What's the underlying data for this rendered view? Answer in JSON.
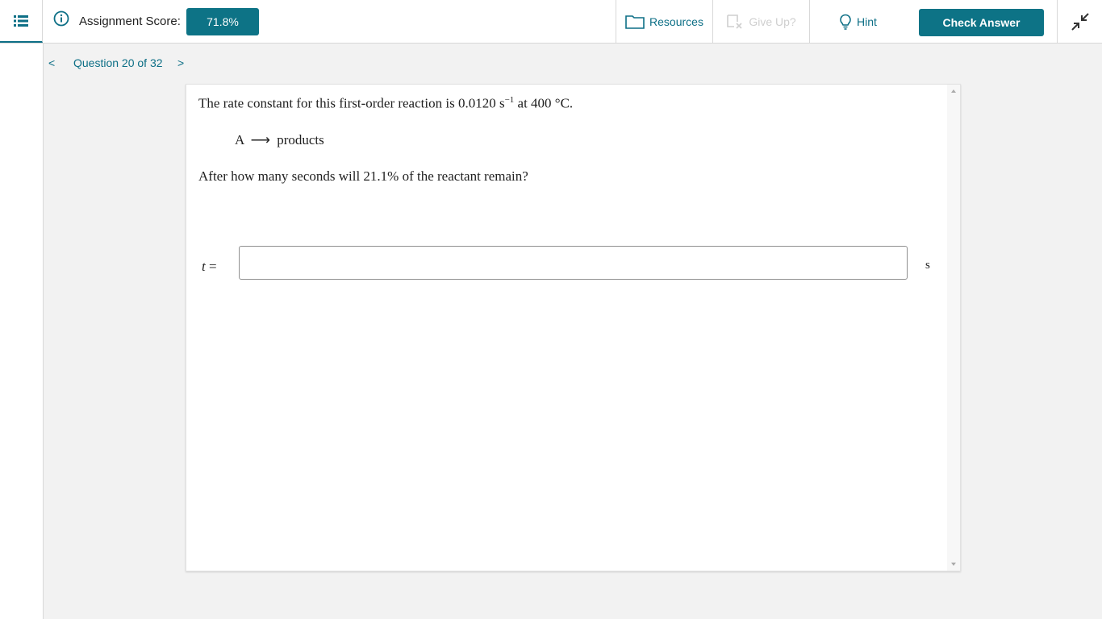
{
  "header": {
    "score_label": "Assignment Score:",
    "score_value": "71.8%",
    "resources_label": "Resources",
    "giveup_label": "Give Up?",
    "hint_label": "Hint",
    "check_answer_label": "Check Answer"
  },
  "icons": {
    "menu": "list-icon",
    "info": "info-icon",
    "resources": "folder-icon",
    "giveup": "give-up-icon",
    "hint": "lightbulb-icon",
    "collapse": "collapse-icon"
  },
  "nav": {
    "prev": "<",
    "question_label": "Question 20 of 32",
    "next": ">"
  },
  "question": {
    "line1_prefix": "The rate constant for this first-order reaction is 0.0120 s",
    "line1_sup": "−1",
    "line1_suffix": " at 400 °C.",
    "reaction_reactant": "A",
    "reaction_arrow": "⟶",
    "reaction_product": "products",
    "line3": "After how many seconds will 21.1% of the reactant remain?",
    "answer_var": "t",
    "answer_eq": " =",
    "answer_value": "",
    "unit": "s"
  },
  "colors": {
    "accent": "#0d7386",
    "disabled": "#cfcfcf"
  }
}
